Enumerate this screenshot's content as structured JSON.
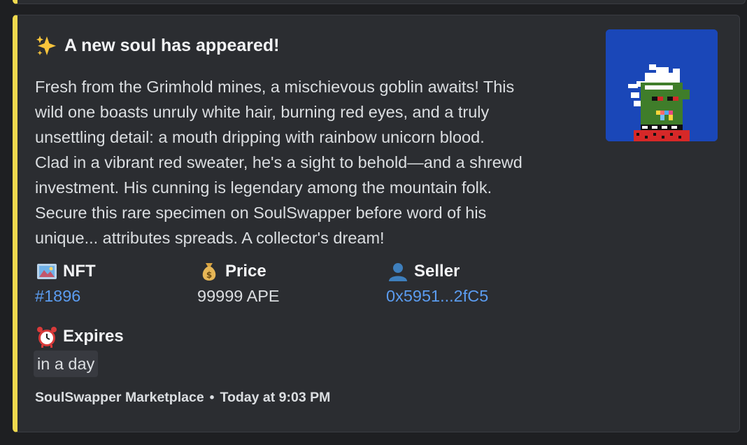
{
  "embed": {
    "accent_color": "#f0d94e",
    "title": "A new soul has appeared!",
    "title_icon": "sparkles-icon",
    "description": "Fresh from the Grimhold mines, a mischievous goblin awaits! This\nwild one boasts unruly white hair, burning red eyes, and a truly\nunsettling detail: a mouth dripping with rainbow unicorn blood.\nClad in a vibrant red sweater, he's a sight to behold—and a shrewd\ninvestment. His cunning is legendary among the mountain folk.\nSecure this rare specimen on SoulSwapper before word of his\nunique... attributes spreads. A collector's dream!",
    "fields": {
      "nft": {
        "icon": "framed-picture-icon",
        "name": "NFT",
        "value": "#1896"
      },
      "price": {
        "icon": "money-bag-icon",
        "name": "Price",
        "value": "99999 APE"
      },
      "seller": {
        "icon": "user-silhouette-icon",
        "name": "Seller",
        "value": "0x5951...2fC5"
      },
      "expires": {
        "icon": "alarm-clock-icon",
        "name": "Expires",
        "value": "in a day"
      }
    },
    "footer": {
      "source": "SoulSwapper Marketplace",
      "separator": "•",
      "timestamp": "Today at 9:03 PM"
    },
    "thumbnail_bg": "#1a47b8"
  }
}
